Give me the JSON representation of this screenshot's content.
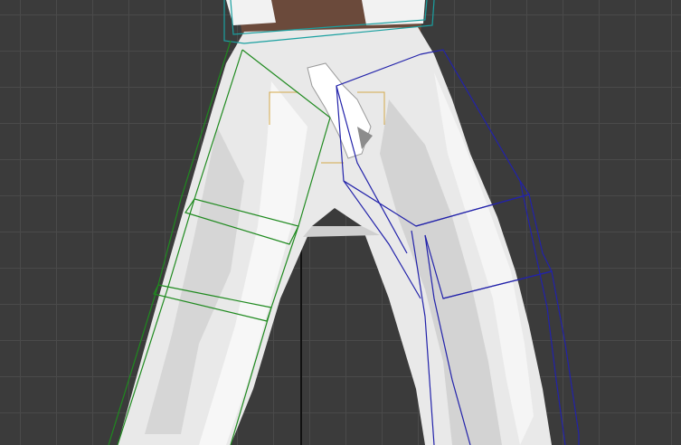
{
  "viewport": {
    "background": "#3b3b3b",
    "grid_color": "#4a4a4a",
    "grid_major_color": "#111111"
  },
  "model": {
    "garment_color": "#e9e9e9",
    "skin_color": "#6b4a3b"
  },
  "bones": {
    "left_leg_color": "#1f8a1f",
    "right_leg_color": "#2222aa",
    "pelvis_color": "#1aa0a0",
    "gizmo_color": "#d4a94a"
  }
}
